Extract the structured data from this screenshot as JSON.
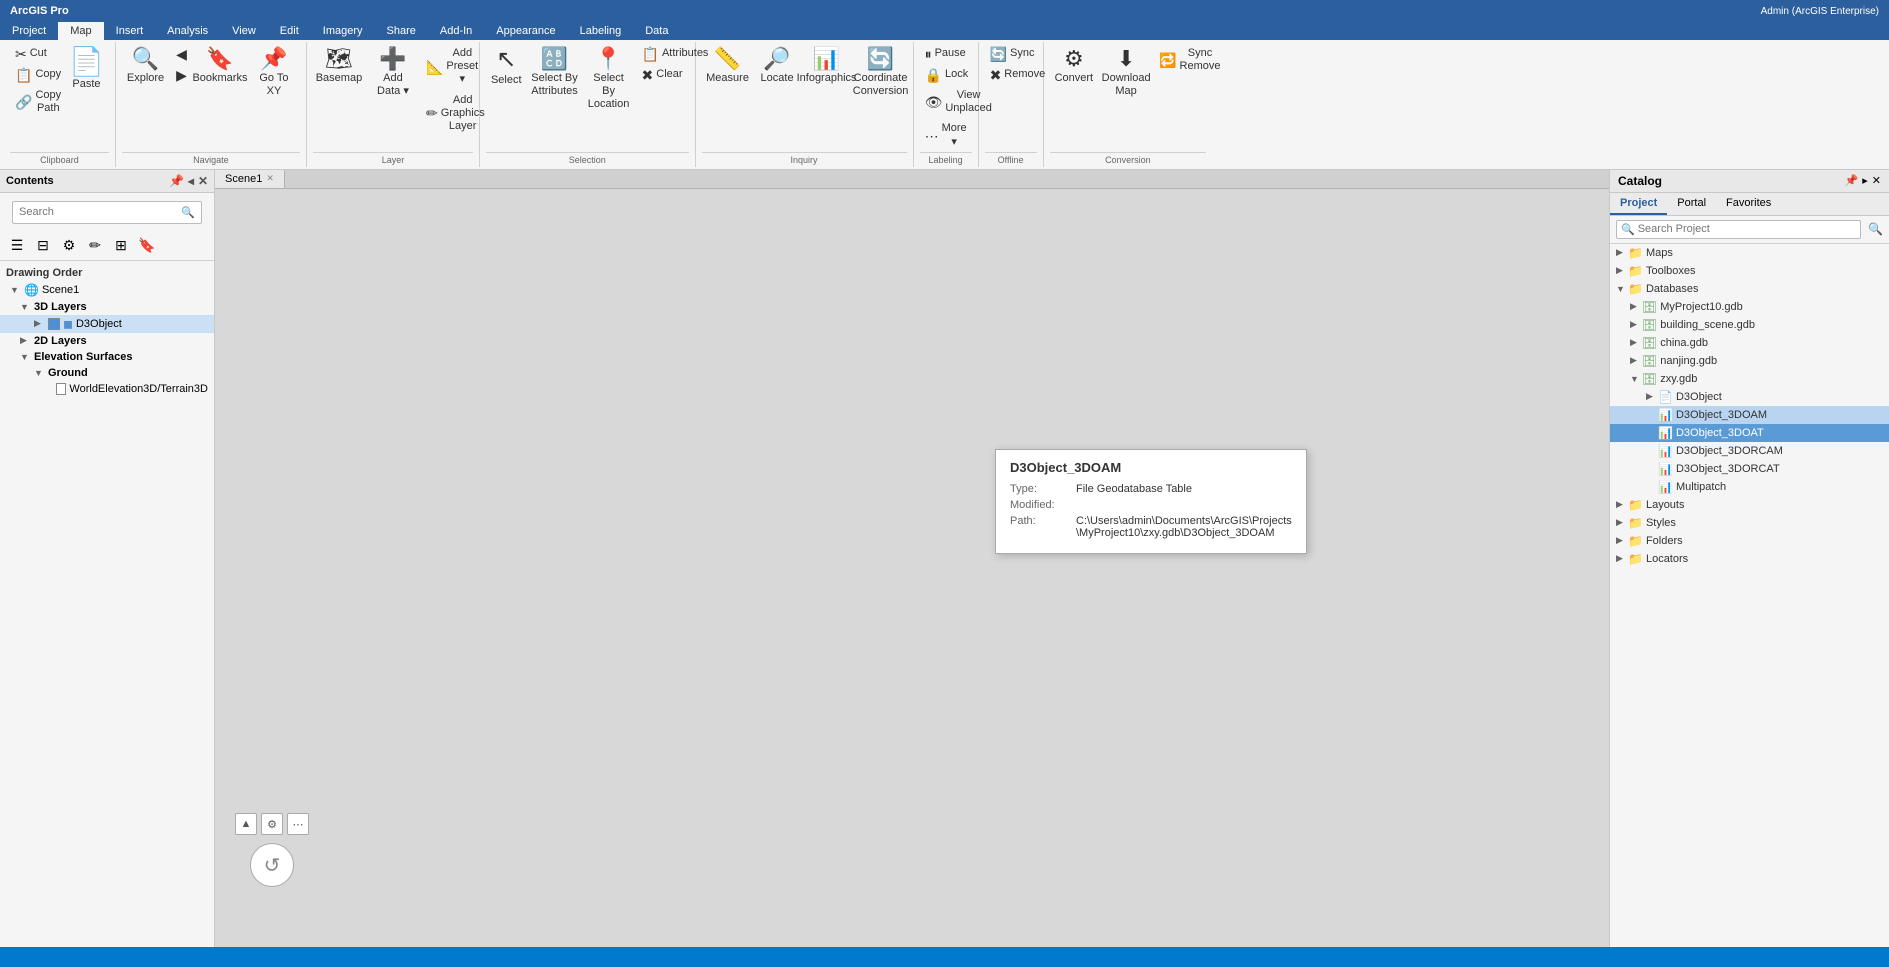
{
  "app": {
    "title": "ArcGIS Pro",
    "user": "Admin (ArcGIS Enterprise)",
    "user_dropdown": "▾"
  },
  "menu": {
    "tabs": [
      "Project",
      "Map",
      "Insert",
      "Analysis",
      "View",
      "Edit",
      "Imagery",
      "Share",
      "Add-In",
      "Appearance",
      "Labeling",
      "Data"
    ]
  },
  "ribbon": {
    "clipboard_group": {
      "label": "Clipboard",
      "buttons": [
        {
          "id": "cut",
          "icon": "✂",
          "label": "Cut"
        },
        {
          "id": "copy",
          "icon": "📋",
          "label": "Copy"
        },
        {
          "id": "paste",
          "icon": "📄",
          "label": "Paste"
        },
        {
          "id": "copy-path",
          "icon": "🔗",
          "label": "Copy Path"
        }
      ]
    },
    "navigate_group": {
      "label": "Navigate",
      "buttons": [
        {
          "id": "explore",
          "icon": "🔍",
          "label": "Explore"
        },
        {
          "id": "bookmarks",
          "icon": "🔖",
          "label": "Bookmarks"
        },
        {
          "id": "go-to-xy",
          "icon": "📌",
          "label": "Go To XY"
        }
      ]
    },
    "layer_group": {
      "label": "Layer",
      "buttons": [
        {
          "id": "basemap",
          "icon": "🗺",
          "label": "Basemap"
        },
        {
          "id": "add",
          "icon": "➕",
          "label": "Add Data ▾"
        },
        {
          "id": "add-preset",
          "icon": "📐",
          "label": "Add Preset ▾"
        },
        {
          "id": "add-graphics",
          "icon": "✏",
          "label": "Add Graphics Layer"
        }
      ]
    },
    "selection_group": {
      "label": "Selection",
      "buttons": [
        {
          "id": "select",
          "icon": "↖",
          "label": "Select"
        },
        {
          "id": "select-by-attr",
          "icon": "🔠",
          "label": "Select By Attributes"
        },
        {
          "id": "select-by-loc",
          "icon": "📍",
          "label": "Select By Location"
        },
        {
          "id": "attributes",
          "icon": "📋",
          "label": "Attributes"
        },
        {
          "id": "clear",
          "icon": "🗑",
          "label": "Clear"
        }
      ]
    },
    "inquiry_group": {
      "label": "Inquiry",
      "buttons": [
        {
          "id": "measure",
          "icon": "📏",
          "label": "Measure"
        },
        {
          "id": "locate",
          "icon": "🔎",
          "label": "Locate"
        },
        {
          "id": "infographics",
          "icon": "📊",
          "label": "Infographics"
        },
        {
          "id": "coordinate-conv",
          "icon": "🔄",
          "label": "Coordinate Conversion"
        }
      ]
    },
    "labeling_group": {
      "label": "Labeling",
      "buttons": [
        {
          "id": "pause",
          "icon": "⏸",
          "label": "Pause"
        },
        {
          "id": "lock",
          "icon": "🔒",
          "label": "Lock"
        },
        {
          "id": "view-unplaced",
          "icon": "👁",
          "label": "View Unplaced"
        },
        {
          "id": "more",
          "icon": "⋯",
          "label": "More ▾"
        }
      ]
    },
    "offline_group": {
      "label": "Offline",
      "buttons": [
        {
          "id": "sync",
          "icon": "🔄",
          "label": "Sync"
        },
        {
          "id": "remove",
          "icon": "✖",
          "label": "Remove"
        }
      ]
    },
    "convert_group": {
      "label": "",
      "buttons": [
        {
          "id": "convert",
          "icon": "⚙",
          "label": "Convert"
        },
        {
          "id": "download-map",
          "icon": "⬇",
          "label": "Download Map"
        },
        {
          "id": "sync-remove",
          "icon": "🔁",
          "label": "Sync Remove"
        }
      ]
    }
  },
  "contents_panel": {
    "title": "Contents",
    "search_placeholder": "Search",
    "toolbar_icons": [
      "list-view",
      "filter",
      "settings",
      "pencil",
      "add-layer",
      "bookmark"
    ],
    "drawing_order": "Drawing Order",
    "items": [
      {
        "id": "scene1",
        "label": "Scene1",
        "level": 0,
        "type": "scene",
        "expanded": true
      },
      {
        "id": "3d-layers",
        "label": "3D Layers",
        "level": 1,
        "type": "group",
        "expanded": true
      },
      {
        "id": "d3object",
        "label": "D3Object",
        "level": 2,
        "type": "layer",
        "selected": true,
        "checked": true
      },
      {
        "id": "2d-layers",
        "label": "2D Layers",
        "level": 1,
        "type": "group",
        "expanded": false
      },
      {
        "id": "elevation-surfaces",
        "label": "Elevation Surfaces",
        "level": 1,
        "type": "group",
        "expanded": true
      },
      {
        "id": "ground",
        "label": "Ground",
        "level": 2,
        "type": "group",
        "expanded": true
      },
      {
        "id": "worldelevation",
        "label": "WorldElevation3D/Terrain3D",
        "level": 3,
        "type": "layer",
        "checked": false
      }
    ]
  },
  "map": {
    "tabs": [
      {
        "label": "Scene1",
        "active": true
      }
    ],
    "background_color": "#d8d8d8"
  },
  "tooltip": {
    "title": "D3Object_3DOAM",
    "type_label": "Type:",
    "type_value": "File Geodatabase Table",
    "modified_label": "Modified:",
    "modified_value": "",
    "path_label": "Path:",
    "path_value": "C:\\Users\\admin\\Documents\\ArcGIS\\Projects\\MyProject10\\zxy.gdb\\D3Object_3DOAM"
  },
  "catalog_panel": {
    "title": "Catalog",
    "tabs": [
      "Project",
      "Portal",
      "Favorites"
    ],
    "active_tab": "Project",
    "search_placeholder": "Search Project",
    "items": [
      {
        "id": "maps",
        "label": "Maps",
        "level": 0,
        "expanded": false,
        "type": "folder"
      },
      {
        "id": "toolboxes",
        "label": "Toolboxes",
        "level": 0,
        "expanded": false,
        "type": "folder"
      },
      {
        "id": "databases",
        "label": "Databases",
        "level": 0,
        "expanded": true,
        "type": "folder"
      },
      {
        "id": "myproject10",
        "label": "MyProject10.gdb",
        "level": 1,
        "expanded": false,
        "type": "db"
      },
      {
        "id": "building-scene",
        "label": "building_scene.gdb",
        "level": 1,
        "expanded": false,
        "type": "db"
      },
      {
        "id": "china",
        "label": "china.gdb",
        "level": 1,
        "expanded": false,
        "type": "db"
      },
      {
        "id": "nanjing",
        "label": "nanjing.gdb",
        "level": 1,
        "expanded": false,
        "type": "db"
      },
      {
        "id": "zxy",
        "label": "zxy.gdb",
        "level": 1,
        "expanded": true,
        "type": "db"
      },
      {
        "id": "d3object-cat",
        "label": "D3Object",
        "level": 2,
        "expanded": false,
        "type": "table"
      },
      {
        "id": "d3object-3doam",
        "label": "D3Object_3DOAM",
        "level": 2,
        "expanded": false,
        "type": "table",
        "selected": true
      },
      {
        "id": "d3object-3doat",
        "label": "D3Object_3DOAT",
        "level": 2,
        "expanded": false,
        "type": "table",
        "selected-blue": true
      },
      {
        "id": "d3object-3dorcam",
        "label": "D3Object_3DORCAM",
        "level": 2,
        "expanded": false,
        "type": "table"
      },
      {
        "id": "d3object-3dorcat",
        "label": "D3Object_3DORCAT",
        "level": 2,
        "expanded": false,
        "type": "table"
      },
      {
        "id": "multipatch",
        "label": "Multipatch",
        "level": 2,
        "expanded": false,
        "type": "table"
      },
      {
        "id": "layouts",
        "label": "Layouts",
        "level": 0,
        "expanded": false,
        "type": "folder"
      },
      {
        "id": "styles",
        "label": "Styles",
        "level": 0,
        "expanded": false,
        "type": "folder"
      },
      {
        "id": "folders",
        "label": "Folders",
        "level": 0,
        "expanded": false,
        "type": "folder"
      },
      {
        "id": "locators",
        "label": "Locators",
        "level": 0,
        "expanded": false,
        "type": "folder"
      }
    ]
  },
  "status_bar": {
    "text": ""
  }
}
